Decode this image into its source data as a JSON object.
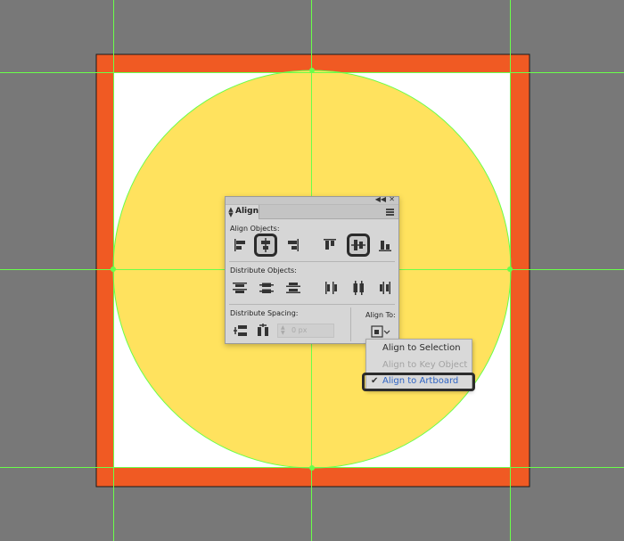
{
  "colors": {
    "background": "#787878",
    "artboard_frame": "#f05a23",
    "artboard_fill": "#ffffff",
    "circle_fill": "#ffe25e",
    "guide": "#6aff4a",
    "panel_bg": "#d6d6d6",
    "selected_text": "#2f64c4"
  },
  "align_panel": {
    "tab_title": "Align",
    "align_objects_label": "Align Objects:",
    "distribute_objects_label": "Distribute Objects:",
    "distribute_spacing_label": "Distribute Spacing:",
    "align_to_label": "Align To:",
    "spacing_value": "0 px",
    "align_buttons": [
      {
        "icon": "horizontal-align-left-icon",
        "highlighted": false
      },
      {
        "icon": "horizontal-align-center-icon",
        "highlighted": true
      },
      {
        "icon": "horizontal-align-right-icon",
        "highlighted": false
      },
      {
        "icon": "vertical-align-top-icon",
        "highlighted": false
      },
      {
        "icon": "vertical-align-center-icon",
        "highlighted": true
      },
      {
        "icon": "vertical-align-bottom-icon",
        "highlighted": false
      }
    ],
    "distribute_buttons": [
      {
        "icon": "vertical-distribute-top-icon"
      },
      {
        "icon": "vertical-distribute-center-icon"
      },
      {
        "icon": "vertical-distribute-bottom-icon"
      },
      {
        "icon": "horizontal-distribute-left-icon"
      },
      {
        "icon": "horizontal-distribute-center-icon"
      },
      {
        "icon": "horizontal-distribute-right-icon"
      }
    ]
  },
  "align_to_menu": {
    "items": [
      {
        "label": "Align to Selection",
        "state": "normal"
      },
      {
        "label": "Align to Key Object",
        "state": "disabled"
      },
      {
        "label": "Align to Artboard",
        "state": "selected",
        "checked": true
      }
    ]
  }
}
